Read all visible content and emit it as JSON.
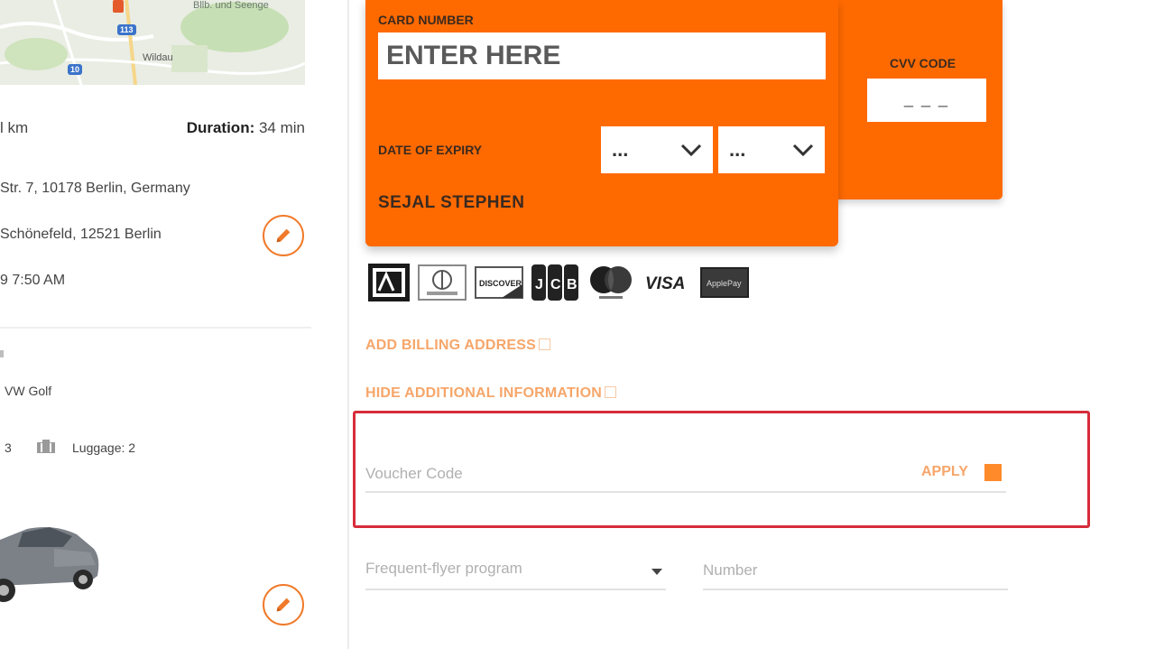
{
  "map": {
    "label_wildau": "Wildau",
    "label_lake": "Bllb. und Seenge",
    "shield_1": "113",
    "shield_2": "10"
  },
  "trip": {
    "distance": "l km",
    "duration_label": "Duration:",
    "duration_value": "34 min",
    "pickup_address": "Str. 7, 10178 Berlin, Germany",
    "dropoff_address": "Schönefeld, 12521 Berlin",
    "pickup_time": "9   7:50 AM"
  },
  "vehicle": {
    "model": "VW Golf",
    "passengers": "3",
    "luggage": "Luggage: 2"
  },
  "card": {
    "number_label": "CARD NUMBER",
    "number_placeholder": "ENTER HERE",
    "expiry_label": "DATE OF EXPIRY",
    "month_value": "...",
    "year_value": "...",
    "holder_name": "SEJAL STEPHEN",
    "cvv_label": "CVV CODE",
    "cvv_placeholder": "_ _ _",
    "logos": [
      "amex-logo",
      "diners-club-logo",
      "discover-logo",
      "jcb-logo",
      "mastercard-logo",
      "visa-logo",
      "applepay-logo"
    ],
    "visa_text": "VISA",
    "discover_text": "DISCOVER",
    "applepay_text": "ApplePay"
  },
  "links": {
    "billing": "ADD BILLING ADDRESS",
    "hide_info": "HIDE ADDITIONAL INFORMATION"
  },
  "voucher": {
    "placeholder": "Voucher Code",
    "apply_label": "APPLY"
  },
  "frequent_flyer": {
    "program_placeholder": "Frequent-flyer program",
    "number_placeholder": "Number"
  },
  "colors": {
    "accent": "#ff6a00",
    "link": "#f6a66a",
    "highlight": "#d62c3a"
  }
}
